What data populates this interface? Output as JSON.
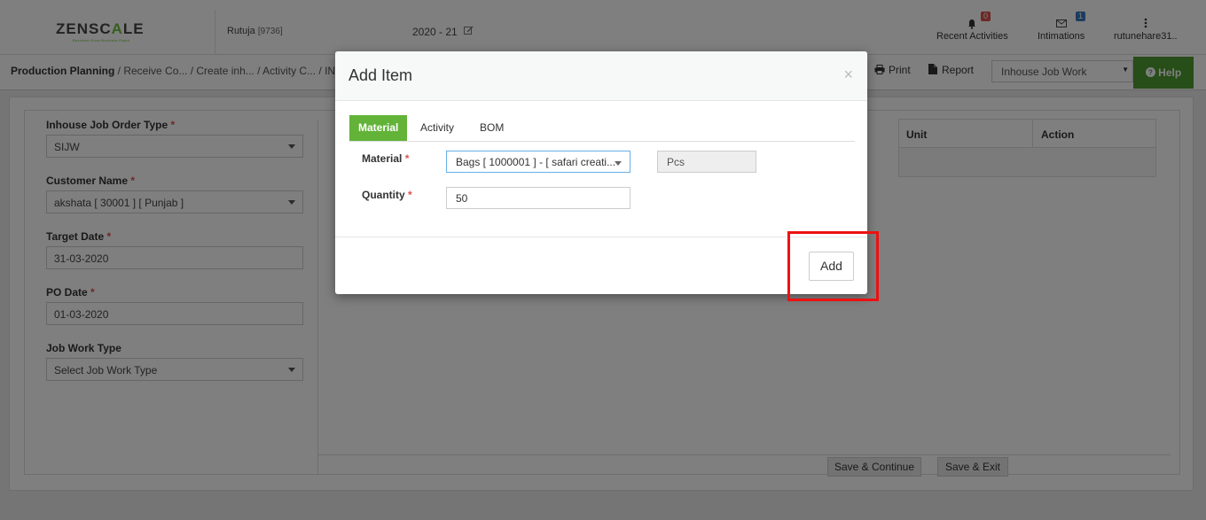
{
  "header": {
    "logo_pre": "ZENSC",
    "logo_accent": "A",
    "logo_post": "LE",
    "logo_tagline": "Business Grow Business Rapid",
    "user_name": "Rutuja",
    "user_code": "[9736]",
    "financial_year": "2020 - 21",
    "recent_activities_label": "Recent Activities",
    "recent_activities_count": "0",
    "intimations_label": "Intimations",
    "intimations_count": "1",
    "username_label": "rutunehare31.."
  },
  "breadcrumb": {
    "root": "Production Planning",
    "rest": "/ Receive Co... / Create inh... / Activity C... / IN h"
  },
  "toolbar": {
    "print_label": "Print",
    "report_label": "Report",
    "job_work_select": "Inhouse Job Work",
    "help_label": "Help"
  },
  "form": {
    "order_type_label": "Inhouse Job Order Type",
    "order_type_value": "SIJW",
    "customer_label": "Customer Name",
    "customer_value": "akshata [ 30001 ] [ Punjab ]",
    "target_date_label": "Target Date",
    "target_date_value": "31-03-2020",
    "po_date_label": "PO Date",
    "po_date_value": "01-03-2020",
    "job_work_type_label": "Job Work Type",
    "job_work_type_placeholder": "Select Job Work Type"
  },
  "grid": {
    "columns": [
      "Unit",
      "Action"
    ]
  },
  "actions": {
    "save_continue": "Save & Continue",
    "save_exit": "Save & Exit"
  },
  "modal": {
    "title": "Add Item",
    "close": "×",
    "tabs": [
      "Material",
      "Activity",
      "BOM"
    ],
    "material_label": "Material",
    "material_value": "Bags [ 1000001 ] - [ safari creati...",
    "unit_value": "Pcs",
    "quantity_label": "Quantity",
    "quantity_value": "50",
    "add_button": "Add"
  },
  "colors": {
    "accent_green": "#62b338",
    "help_green": "#4f9a30",
    "highlight_red": "#e11111",
    "required_red": "#d9534f"
  }
}
